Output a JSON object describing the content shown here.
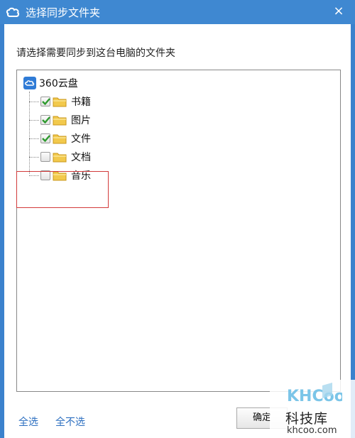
{
  "window": {
    "title": "选择同步文件夹",
    "close_symbol": "×"
  },
  "instruction": "请选择需要同步到这台电脑的文件夹",
  "tree": {
    "root": {
      "label": "360云盘",
      "icon": "360-cloud-icon"
    },
    "items": [
      {
        "label": "书籍",
        "checked": true
      },
      {
        "label": "图片",
        "checked": true
      },
      {
        "label": "文件",
        "checked": true
      },
      {
        "label": "文档",
        "checked": false
      },
      {
        "label": "音乐",
        "checked": false
      }
    ]
  },
  "footer": {
    "select_all": "全选",
    "select_none": "全不选",
    "ok_button": "确定"
  },
  "watermark": {
    "logo_text": "KHCoo",
    "site_name": "科技库",
    "url": "khcoo.com"
  },
  "colors": {
    "titlebar": "#3f88d1",
    "link": "#2d6fc0",
    "check": "#2e9a2e",
    "folder": "#f2c94c",
    "highlight": "#d23a3a"
  }
}
